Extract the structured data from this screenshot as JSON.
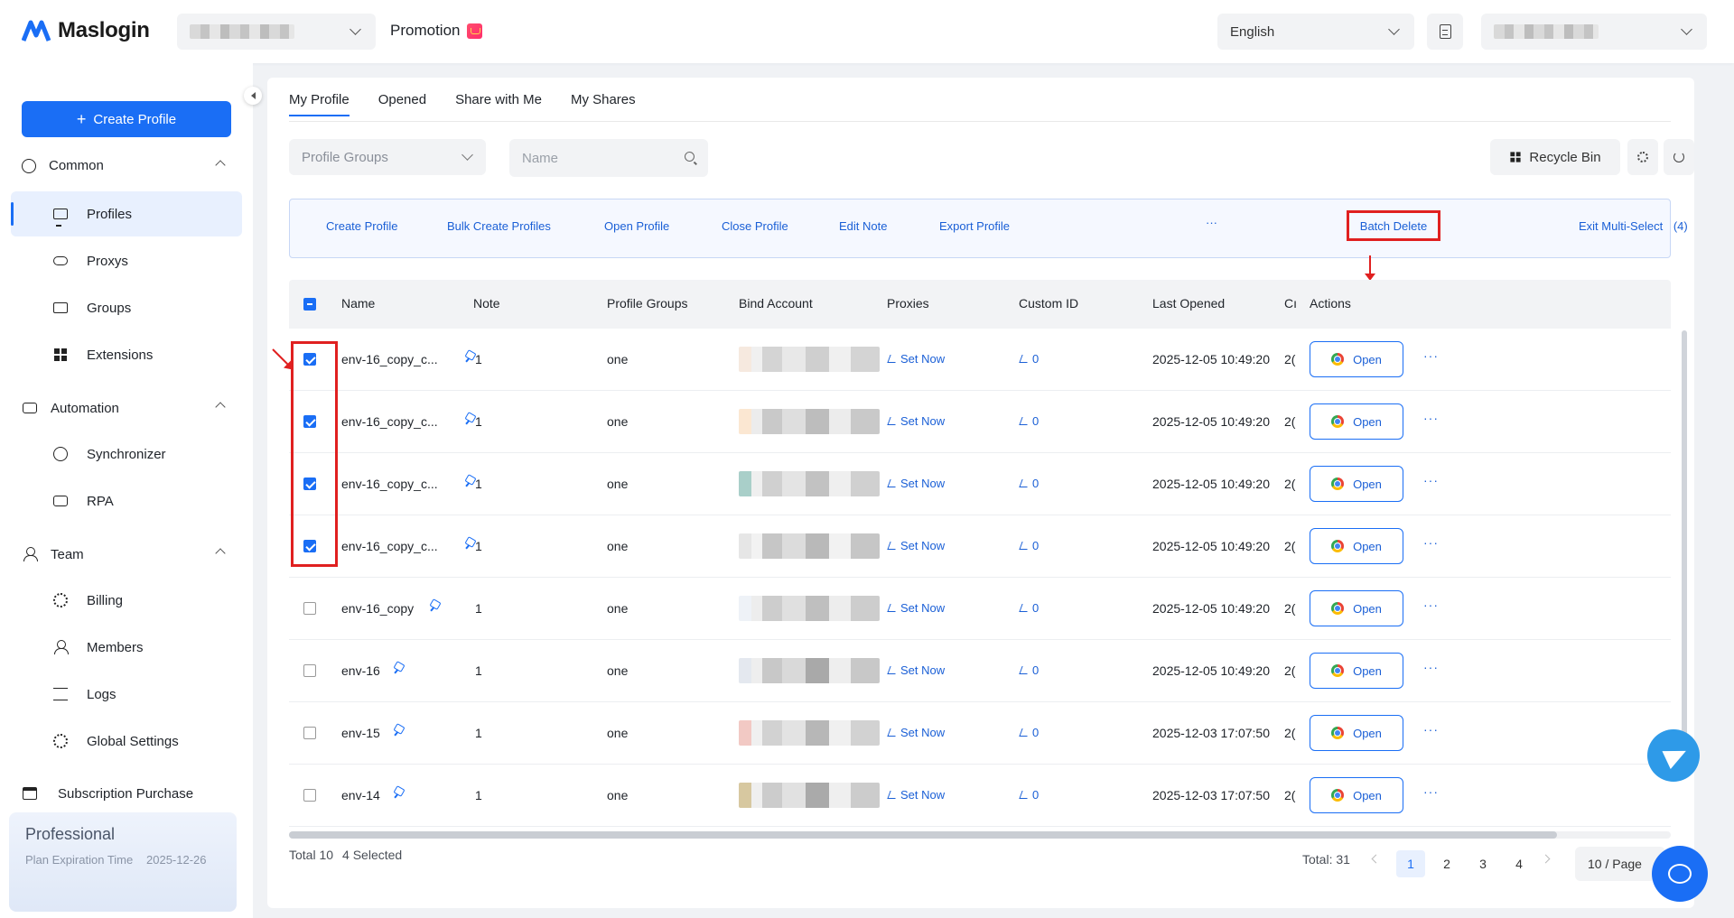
{
  "app": {
    "brand": "Maslogin",
    "promotion_label": "Promotion",
    "language": "English"
  },
  "sidebar": {
    "create_label": "Create Profile",
    "sections": [
      {
        "label": "Common",
        "icon": "globe-icon",
        "items": [
          {
            "label": "Profiles",
            "icon": "monitor-icon",
            "active": true
          },
          {
            "label": "Proxys",
            "icon": "cloud-icon"
          },
          {
            "label": "Groups",
            "icon": "folder-icon"
          },
          {
            "label": "Extensions",
            "icon": "grid-icon"
          }
        ]
      },
      {
        "label": "Automation",
        "icon": "robot-icon",
        "items": [
          {
            "label": "Synchronizer",
            "icon": "sync-icon"
          },
          {
            "label": "RPA",
            "icon": "robot-icon"
          }
        ]
      },
      {
        "label": "Team",
        "icon": "team-icon",
        "items": [
          {
            "label": "Billing",
            "icon": "billing-icon"
          },
          {
            "label": "Members",
            "icon": "user-icon"
          },
          {
            "label": "Logs",
            "icon": "layers-icon"
          },
          {
            "label": "Global Settings",
            "icon": "gear-icon"
          }
        ]
      }
    ],
    "subscription_label": "Subscription Purchase",
    "plan": {
      "name": "Professional",
      "expiration_label": "Plan Expiration Time",
      "expiration_value": "2025-12-26"
    }
  },
  "tabs": [
    "My Profile",
    "Opened",
    "Share with Me",
    "My Shares"
  ],
  "toolbar": {
    "groups_placeholder": "Profile Groups",
    "name_placeholder": "Name",
    "recycle_label": "Recycle Bin"
  },
  "batch_actions": {
    "create": "Create Profile",
    "bulk_create": "Bulk Create Profiles",
    "open": "Open Profile",
    "close": "Close Profile",
    "edit_note": "Edit Note",
    "export": "Export Profile",
    "batch_delete": "Batch Delete",
    "more": "···",
    "exit_multi": "Exit Multi-Select",
    "selected_count": "(4)"
  },
  "table": {
    "columns": {
      "name": "Name",
      "note": "Note",
      "groups": "Profile Groups",
      "bind": "Bind Account",
      "proxies": "Proxies",
      "custom_id": "Custom ID",
      "last_opened": "Last Opened",
      "created_trunc": "Cı",
      "actions": "Actions"
    },
    "set_now_label": "Set Now",
    "open_label": "Open",
    "more_label": "···",
    "rows": [
      {
        "name": "env-16_copy_c...",
        "note": "1",
        "group": "one",
        "custom_id": "0",
        "last_opened": "2025-12-05 10:49:20",
        "created_trunc": "2(",
        "checked": true
      },
      {
        "name": "env-16_copy_c...",
        "note": "1",
        "group": "one",
        "custom_id": "0",
        "last_opened": "2025-12-05 10:49:20",
        "created_trunc": "2(",
        "checked": true
      },
      {
        "name": "env-16_copy_c...",
        "note": "1",
        "group": "one",
        "custom_id": "0",
        "last_opened": "2025-12-05 10:49:20",
        "created_trunc": "2(",
        "checked": true
      },
      {
        "name": "env-16_copy_c...",
        "note": "1",
        "group": "one",
        "custom_id": "0",
        "last_opened": "2025-12-05 10:49:20",
        "created_trunc": "2(",
        "checked": true
      },
      {
        "name": "env-16_copy",
        "note": "1",
        "group": "one",
        "custom_id": "0",
        "last_opened": "2025-12-05 10:49:20",
        "created_trunc": "2(",
        "checked": false
      },
      {
        "name": "env-16",
        "note": "1",
        "group": "one",
        "custom_id": "0",
        "last_opened": "2025-12-05 10:49:20",
        "created_trunc": "2(",
        "checked": false
      },
      {
        "name": "env-15",
        "note": "1",
        "group": "one",
        "custom_id": "0",
        "last_opened": "2025-12-03 17:07:50",
        "created_trunc": "2(",
        "checked": false
      },
      {
        "name": "env-14",
        "note": "1",
        "group": "one",
        "custom_id": "0",
        "last_opened": "2025-12-03 17:07:50",
        "created_trunc": "2(",
        "checked": false
      }
    ]
  },
  "footer": {
    "total_label": "Total 10",
    "selected_label": "4 Selected",
    "pager_total": "Total: 31",
    "pages": [
      "1",
      "2",
      "3",
      "4"
    ],
    "current_page": "1",
    "page_size": "10 / Page"
  },
  "colors": {
    "accent": "#1a6ef5",
    "annotation_red": "#e02020",
    "selection_bg": "#f5f8ff"
  }
}
